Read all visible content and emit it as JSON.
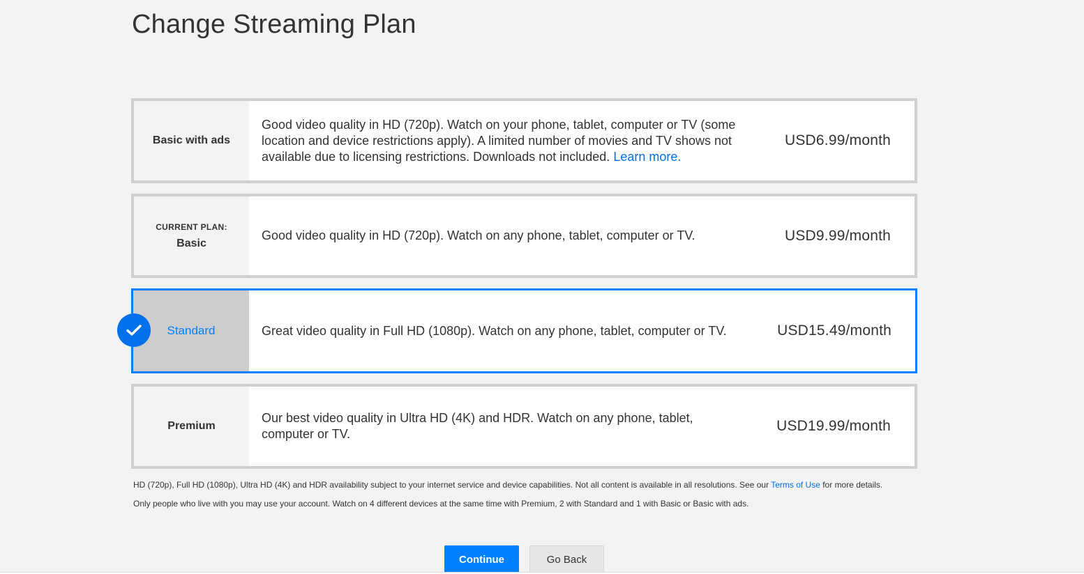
{
  "page": {
    "title": "Change Streaming Plan"
  },
  "plans": [
    {
      "name": "Basic with ads",
      "current_label": "",
      "description": "Good video quality in HD (720p). Watch on your phone, tablet, computer or TV (some location and device restrictions apply). A limited number of movies and TV shows not available due to licensing restrictions. Downloads not included.",
      "link_text": "Learn more.",
      "price": "USD6.99/month",
      "selected": false
    },
    {
      "name": "Basic",
      "current_label": "CURRENT PLAN:",
      "description": "Good video quality in HD (720p). Watch on any phone, tablet, computer or TV.",
      "price": "USD9.99/month",
      "selected": false
    },
    {
      "name": "Standard",
      "current_label": "",
      "description": "Great video quality in Full HD (1080p). Watch on any phone, tablet, computer or TV.",
      "price": "USD15.49/month",
      "selected": true
    },
    {
      "name": "Premium",
      "current_label": "",
      "description": "Our best video quality in Ultra HD (4K) and HDR. Watch on any phone, tablet, computer or TV.",
      "price": "USD19.99/month",
      "selected": false
    }
  ],
  "footnotes": {
    "availability_before": "HD (720p), Full HD (1080p), Ultra HD (4K) and HDR availability subject to your internet service and device capabilities. Not all content is available in all resolutions. See our ",
    "terms_link": "Terms of Use",
    "availability_after": " for more details.",
    "household": "Only people who live with you may use your account. Watch on 4 different devices at the same time with Premium, 2 with Standard and 1 with Basic or Basic with ads."
  },
  "actions": {
    "continue_label": "Continue",
    "back_label": "Go Back"
  },
  "colors": {
    "accent": "#0071eb",
    "selected_border": "#0080ff",
    "background": "#f3f3f3"
  },
  "icons": {
    "selected_indicator": "checkmark-icon"
  }
}
